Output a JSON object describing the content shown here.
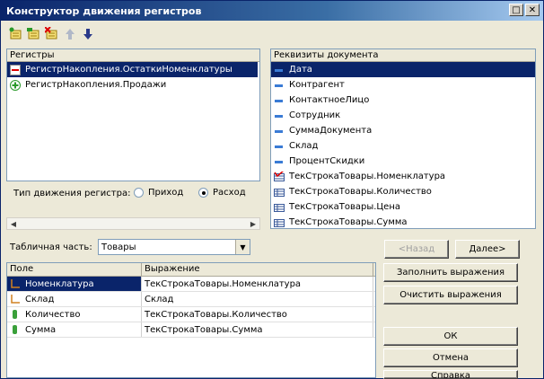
{
  "window": {
    "title": "Конструктор движения регистров"
  },
  "toolbar": {
    "icons": [
      "add-register-icon",
      "add-all-icon",
      "delete-register-icon",
      "move-up-icon",
      "move-down-icon"
    ]
  },
  "registers": {
    "header": "Регистры",
    "items": [
      {
        "label": "РегистрНакопления.ОстаткиНоменклатуры",
        "icon": "minus-icon",
        "selected": true
      },
      {
        "label": "РегистрНакопления.Продажи",
        "icon": "plus-icon",
        "selected": false
      }
    ]
  },
  "movement": {
    "label": "Тип движения регистра:",
    "options": [
      {
        "label": "Приход",
        "checked": false
      },
      {
        "label": "Расход",
        "checked": true
      }
    ]
  },
  "requisites": {
    "header": "Реквизиты документа",
    "items": [
      {
        "label": "Дата",
        "type": "attr",
        "selected": true
      },
      {
        "label": "Контрагент",
        "type": "attr"
      },
      {
        "label": "КонтактноеЛицо",
        "type": "attr"
      },
      {
        "label": "Сотрудник",
        "type": "attr"
      },
      {
        "label": "СуммаДокумента",
        "type": "attr"
      },
      {
        "label": "Склад",
        "type": "attr"
      },
      {
        "label": "ПроцентСкидки",
        "type": "attr"
      },
      {
        "label": "ТекСтрокаТовары.Номенклатура",
        "type": "table-checked"
      },
      {
        "label": "ТекСтрокаТовары.Количество",
        "type": "table"
      },
      {
        "label": "ТекСтрокаТовары.Цена",
        "type": "table"
      },
      {
        "label": "ТекСтрокаТовары.Сумма",
        "type": "table"
      }
    ]
  },
  "tabular": {
    "label": "Табличная часть:",
    "value": "Товары"
  },
  "nav": {
    "back": "<Назад",
    "next": "Далее>"
  },
  "grid": {
    "columns": [
      "Поле",
      "Выражение"
    ],
    "rows": [
      {
        "field": "Номенклатура",
        "expr": "ТекСтрокаТовары.Номенклатура",
        "icon": "dimension-icon",
        "selected": true
      },
      {
        "field": "Склад",
        "expr": "Склад",
        "icon": "dimension-icon",
        "selected": false
      },
      {
        "field": "Количество",
        "expr": "ТекСтрокаТовары.Количество",
        "icon": "resource-icon",
        "selected": false
      },
      {
        "field": "Сумма",
        "expr": "ТекСтрокаТовары.Сумма",
        "icon": "resource-icon",
        "selected": false
      }
    ]
  },
  "actions": {
    "fill": "Заполнить выражения",
    "clear": "Очистить выражения",
    "ok": "ОК",
    "cancel": "Отмена",
    "help": "Справка"
  },
  "colors": {
    "title_start": "#0a246a",
    "title_end": "#a6caf0",
    "selection": "#0a246a"
  }
}
